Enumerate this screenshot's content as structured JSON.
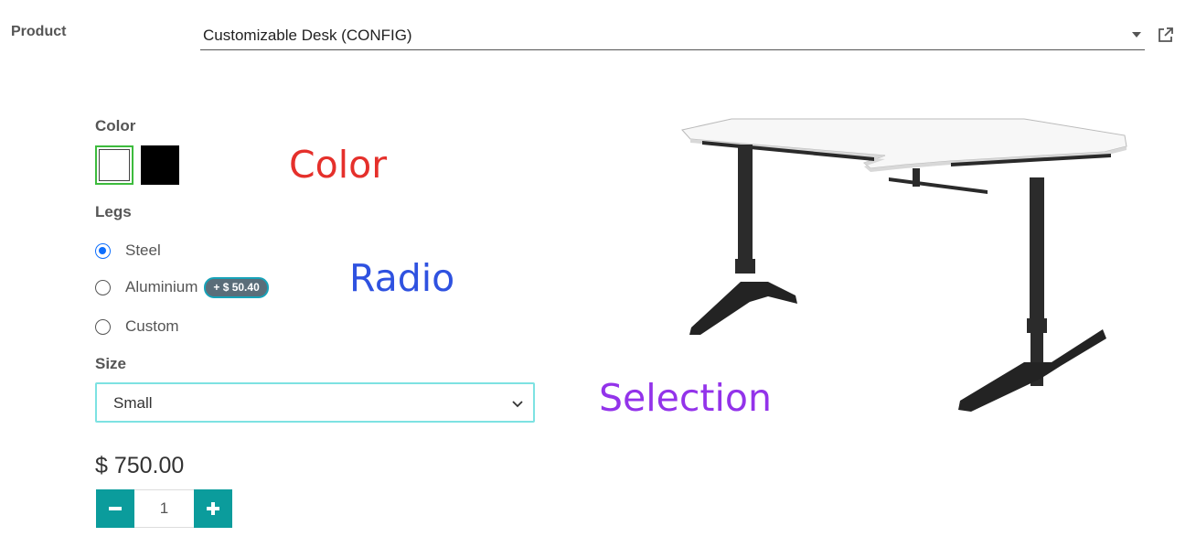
{
  "product": {
    "label": "Product",
    "value": "Customizable Desk (CONFIG)"
  },
  "attributes": {
    "color": {
      "title": "Color",
      "swatches": [
        {
          "name": "White",
          "hex": "#ffffff",
          "selected": true
        },
        {
          "name": "Black",
          "hex": "#000000",
          "selected": false
        }
      ]
    },
    "legs": {
      "title": "Legs",
      "options": [
        {
          "label": "Steel",
          "selected": true
        },
        {
          "label": "Aluminium",
          "selected": false,
          "extra": "+ $ 50.40"
        },
        {
          "label": "Custom",
          "selected": false
        }
      ]
    },
    "size": {
      "title": "Size",
      "selected": "Small"
    }
  },
  "annotations": {
    "color": "Color",
    "radio": "Radio",
    "selection": "Selection"
  },
  "price": "$ 750.00",
  "quantity": {
    "value": "1",
    "minus_icon": "minus-icon",
    "plus_icon": "plus-icon"
  },
  "colors": {
    "accent": "#0b9c9c",
    "selected_swatch_border": "#3dbb3d",
    "radio_checked": "#0d6efd",
    "select_focus_border": "#7de2e2"
  }
}
